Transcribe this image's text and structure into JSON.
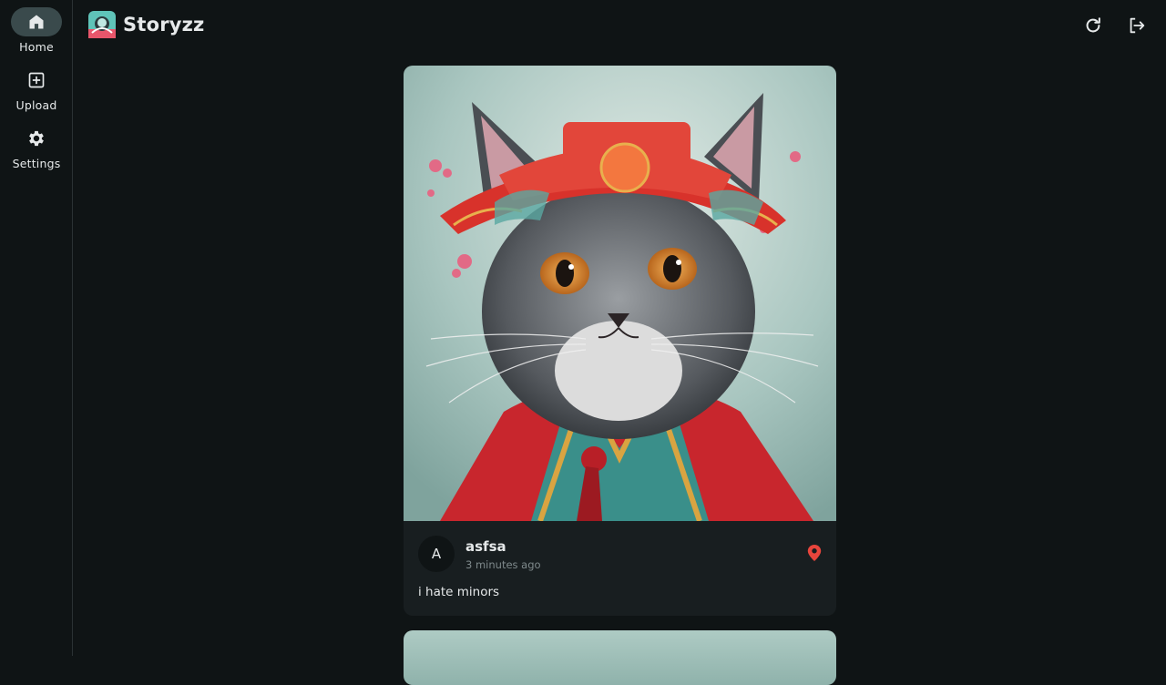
{
  "sidebar": {
    "items": [
      {
        "label": "Home",
        "icon": "home-icon",
        "active": true
      },
      {
        "label": "Upload",
        "icon": "upload-icon",
        "active": false
      },
      {
        "label": "Settings",
        "icon": "gear-icon",
        "active": false
      }
    ]
  },
  "header": {
    "app_name": "Storyzz",
    "actions": [
      {
        "icon": "refresh-icon"
      },
      {
        "icon": "logout-icon"
      }
    ]
  },
  "feed": {
    "posts": [
      {
        "avatar_letter": "A",
        "username": "asfsa",
        "time": "3 minutes ago",
        "description": "i hate minors",
        "location_icon": "location-pin-icon"
      }
    ]
  },
  "colors": {
    "background": "#0f1415",
    "card": "#181e20",
    "active_pill": "#3a4a4c",
    "location_pin": "#e8453c",
    "muted_text": "#7f8a8c"
  }
}
